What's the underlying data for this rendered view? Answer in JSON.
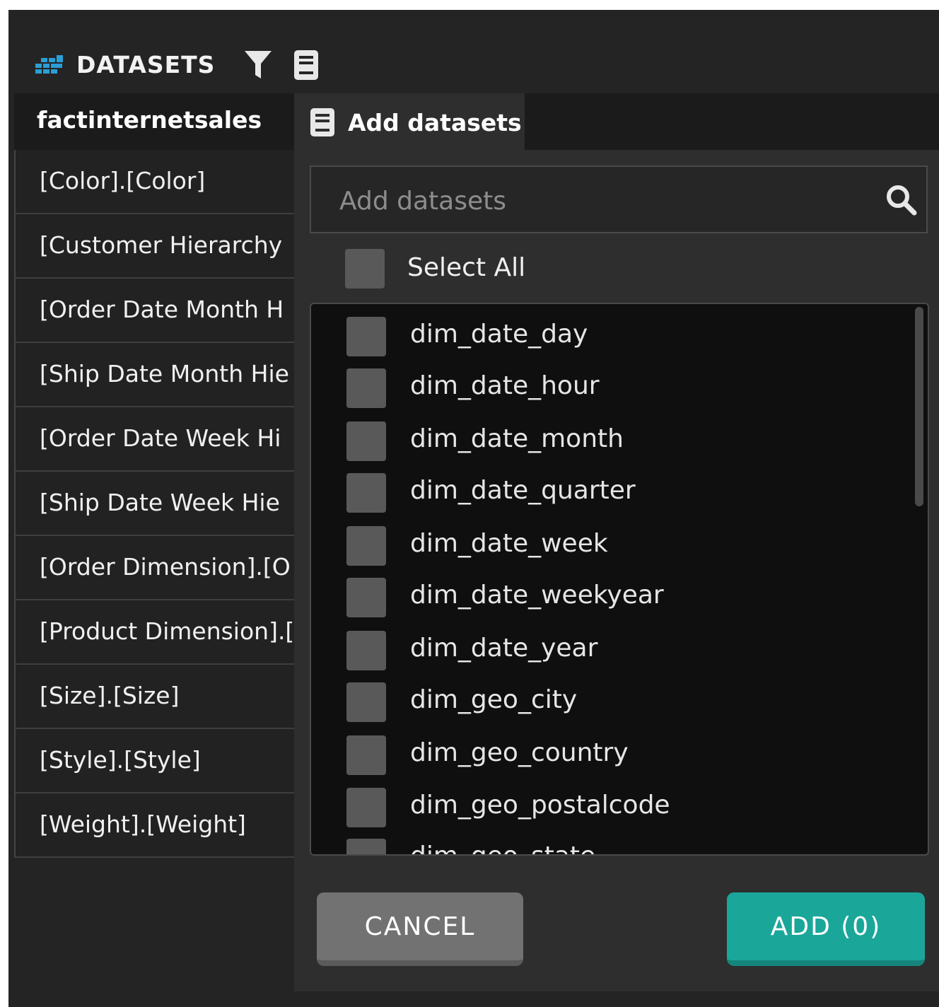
{
  "header": {
    "title": "DATASETS",
    "icons": [
      "datasets-grid-icon",
      "filter-icon",
      "book-icon"
    ]
  },
  "left_panel": {
    "dataset_name": "factinternetsales",
    "items": [
      "[Color].[Color]",
      "[Customer Hierarchy",
      "[Order Date Month H",
      "[Ship Date Month Hie",
      "[Order Date Week Hi",
      "[Ship Date Week Hie",
      "[Order Dimension].[O",
      "[Product Dimension].[",
      "[Size].[Size]",
      "[Style].[Style]",
      "[Weight].[Weight]"
    ]
  },
  "add_panel": {
    "tab_label": "Add datasets",
    "tab_icon": "book-icon",
    "search": {
      "placeholder": "Add datasets",
      "value": "",
      "icon": "search-icon"
    },
    "select_all_label": "Select All",
    "datasets": [
      "dim_date_day",
      "dim_date_hour",
      "dim_date_month",
      "dim_date_quarter",
      "dim_date_week",
      "dim_date_weekyear",
      "dim_date_year",
      "dim_geo_city",
      "dim_geo_country",
      "dim_geo_postalcode",
      "dim_geo_state"
    ],
    "cancel_label": "CANCEL",
    "add_label": "ADD (0)"
  },
  "colors": {
    "background": "#242424",
    "panel": "#2e2e2e",
    "list_bg": "#0f0f0f",
    "accent_teal": "#1aa79a",
    "accent_blue": "#2a9fd6",
    "checkbox": "#595959",
    "cancel_button": "#727272"
  }
}
